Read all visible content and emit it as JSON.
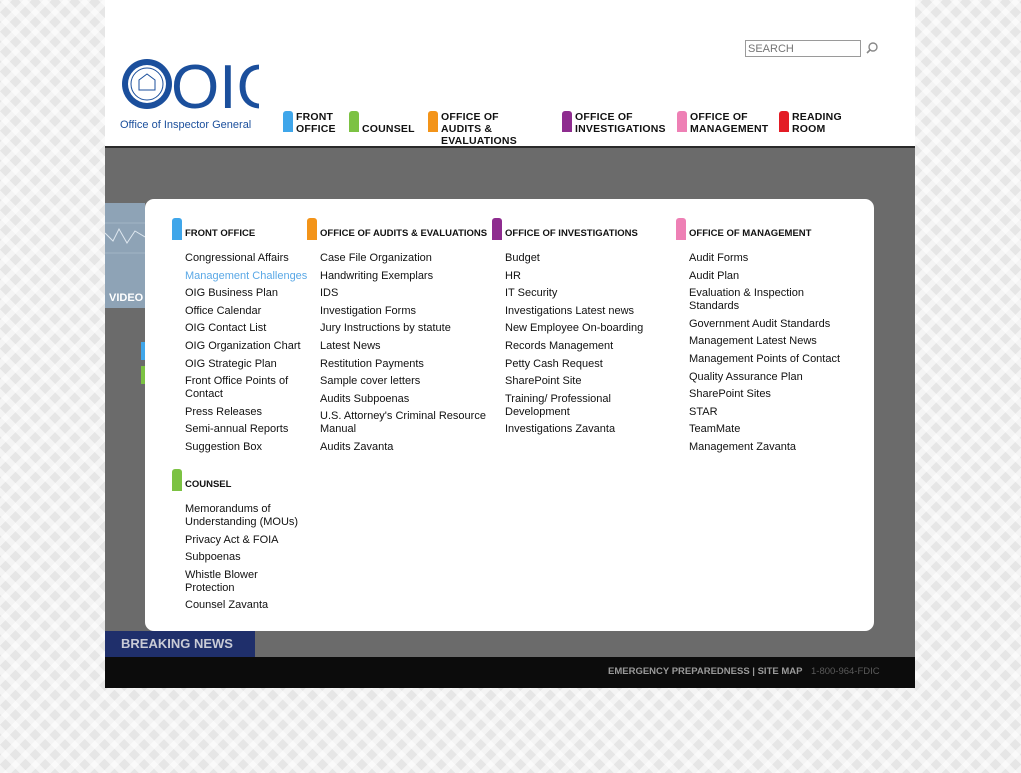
{
  "header": {
    "logo_letters": "OIG",
    "logo_caption": "Office of Inspector General",
    "search_placeholder": "SEARCH"
  },
  "nav": [
    {
      "label": "FRONT\nOFFICE",
      "color": "#3fa6ea"
    },
    {
      "label": "COUNSEL",
      "color": "#7cc243"
    },
    {
      "label": "OFFICE OF AUDITS &\nEVALUATIONS",
      "color": "#f39419"
    },
    {
      "label": "OFFICE OF\nINVESTIGATIONS",
      "color": "#8e2c8f"
    },
    {
      "label": "OFFICE OF\nMANAGEMENT",
      "color": "#ee80b5"
    },
    {
      "label": "READING\nROOM",
      "color": "#e31c25"
    }
  ],
  "background": {
    "video_label": "VIDEO",
    "breaking_news": "BREAKING NEWS"
  },
  "menu": {
    "front_office": {
      "title": "FRONT OFFICE",
      "color": "#3fa6ea",
      "links": [
        "Congressional Affairs",
        "Management Challenges",
        "OIG Business Plan",
        "Office Calendar",
        "OIG Contact List",
        "OIG Organization Chart",
        "OIG Strategic Plan",
        "Front Office Points of Contact",
        "Press Releases",
        "Semi-annual Reports",
        "Suggestion Box"
      ],
      "active_link": "Management Challenges"
    },
    "counsel": {
      "title": "COUNSEL",
      "color": "#7cc243",
      "links": [
        "Memorandums of Understanding (MOUs)",
        "Privacy Act & FOIA",
        "Subpoenas",
        "Whistle Blower Protection",
        "Counsel Zavanta"
      ]
    },
    "audits": {
      "title": "OFFICE OF AUDITS & EVALUATIONS",
      "color": "#f39419",
      "links": [
        "Case File Organization",
        "Handwriting Exemplars",
        "IDS",
        "Investigation Forms",
        "Jury Instructions by statute",
        "Latest News",
        "Restitution Payments",
        "Sample cover letters",
        "Audits Subpoenas",
        "U.S. Attorney's Criminal Resource Manual",
        "Audits Zavanta"
      ]
    },
    "investigations": {
      "title": "OFFICE OF INVESTIGATIONS",
      "color": "#8e2c8f",
      "links": [
        "Budget",
        "HR",
        "IT Security",
        "Investigations Latest news",
        "New Employee On-boarding",
        "Records Management",
        "Petty Cash Request",
        "SharePoint Site",
        "Training/ Professional Development",
        "Investigations Zavanta"
      ]
    },
    "management": {
      "title": "OFFICE OF MANAGEMENT",
      "color": "#ee80b5",
      "links": [
        "Audit Forms",
        "Audit Plan",
        "Evaluation & Inspection Standards",
        "Government Audit Standards",
        "Management Latest News",
        "Management Points of Contact",
        "Quality Assurance Plan",
        "SharePoint Sites",
        "STAR",
        "TeamMate",
        "Management Zavanta"
      ]
    }
  },
  "footer": {
    "links": "EMERGENCY PREPAREDNESS | SITE MAP",
    "phone": "1-800-964-FDIC"
  }
}
